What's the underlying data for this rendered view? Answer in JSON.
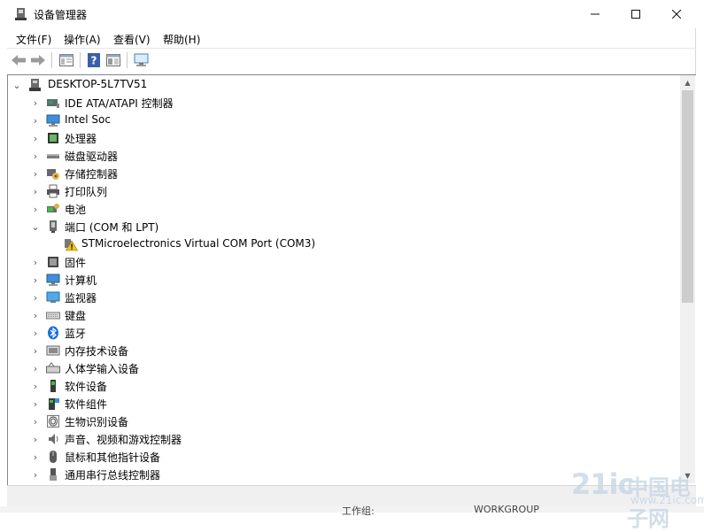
{
  "window": {
    "title": "设备管理器",
    "icon": "device-manager-icon",
    "controls": {
      "minimize": "—",
      "maximize": "☐",
      "close": "✕"
    }
  },
  "menu": [
    "文件(F)",
    "操作(A)",
    "查看(V)",
    "帮助(H)"
  ],
  "toolbar": {
    "buttons": [
      "back-icon",
      "forward-icon",
      "properties-icon",
      "help-icon",
      "view-icon",
      "monitor-scan-icon"
    ]
  },
  "tree": {
    "root": {
      "label": "DESKTOP-5L7TV51",
      "icon": "computer-icon",
      "expanded": true
    },
    "nodes": [
      {
        "label": "IDE ATA/ATAPI 控制器",
        "icon": "ide-controller-icon",
        "expanded": false
      },
      {
        "label": "Intel Soc",
        "icon": "monitor-icon",
        "expanded": false
      },
      {
        "label": "处理器",
        "icon": "processor-icon",
        "expanded": false
      },
      {
        "label": "磁盘驱动器",
        "icon": "disk-drive-icon",
        "expanded": false
      },
      {
        "label": "存储控制器",
        "icon": "storage-controller-icon",
        "expanded": false
      },
      {
        "label": "打印队列",
        "icon": "printer-icon",
        "expanded": false
      },
      {
        "label": "电池",
        "icon": "battery-icon",
        "expanded": false
      },
      {
        "label": "端口 (COM 和 LPT)",
        "icon": "port-icon",
        "expanded": true,
        "children": [
          {
            "label": "STMicroelectronics Virtual COM Port (COM3)",
            "icon": "warning-icon"
          }
        ]
      },
      {
        "label": "固件",
        "icon": "firmware-icon",
        "expanded": false
      },
      {
        "label": "计算机",
        "icon": "computer-monitor-icon",
        "expanded": false
      },
      {
        "label": "监视器",
        "icon": "display-icon",
        "expanded": false
      },
      {
        "label": "键盘",
        "icon": "keyboard-icon",
        "expanded": false
      },
      {
        "label": "蓝牙",
        "icon": "bluetooth-icon",
        "expanded": false
      },
      {
        "label": "内存技术设备",
        "icon": "memory-device-icon",
        "expanded": false
      },
      {
        "label": "人体学输入设备",
        "icon": "hid-icon",
        "expanded": false
      },
      {
        "label": "软件设备",
        "icon": "software-device-icon",
        "expanded": false
      },
      {
        "label": "软件组件",
        "icon": "software-component-icon",
        "expanded": false
      },
      {
        "label": "生物识别设备",
        "icon": "fingerprint-icon",
        "expanded": false
      },
      {
        "label": "声音、视频和游戏控制器",
        "icon": "speaker-icon",
        "expanded": false
      },
      {
        "label": "鼠标和其他指针设备",
        "icon": "mouse-icon",
        "expanded": false
      },
      {
        "label": "通用串行总线控制器",
        "icon": "usb-icon",
        "expanded": false
      }
    ]
  },
  "background_window": {
    "label1": "工作组:",
    "label2": "WORKGROUP"
  },
  "watermark": {
    "text1": "21ic",
    "text2": "中国电子网",
    "text3": "www.21ic.com"
  },
  "colors": {
    "accent": "#0078d7",
    "warning": "#f0c419",
    "bluetooth": "#1a6fd6"
  }
}
